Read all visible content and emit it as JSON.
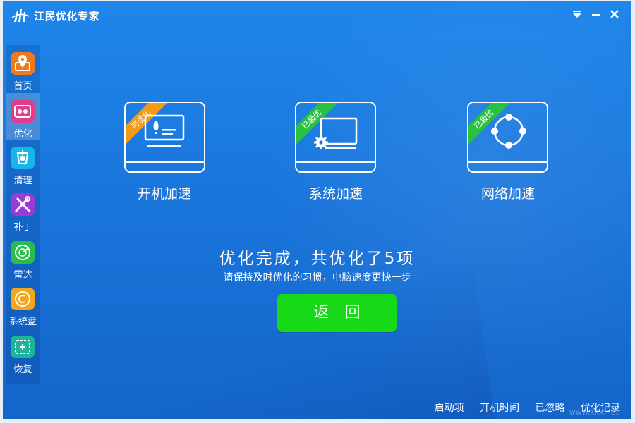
{
  "app": {
    "title": "江民优化专家"
  },
  "window_controls": {
    "menu_icon": "menu-dropdown-icon",
    "min_icon": "minimize-icon",
    "close_icon": "close-icon"
  },
  "sidebar": {
    "items": [
      {
        "label": "首页",
        "icon": "home-location-icon",
        "color": "#f07a1a",
        "active": false
      },
      {
        "label": "优化",
        "icon": "optimize-gauge-icon",
        "color": "#e23b8c",
        "active": true
      },
      {
        "label": "清理",
        "icon": "clean-broom-icon",
        "color": "#1ab5e8",
        "active": false
      },
      {
        "label": "补丁",
        "icon": "patch-tools-icon",
        "color": "#9b3ad6",
        "active": false
      },
      {
        "label": "雷达",
        "icon": "radar-icon",
        "color": "#2bbd4b",
        "active": false
      },
      {
        "label": "系统盘",
        "icon": "system-disk-icon",
        "color": "#f3a51b",
        "active": false
      },
      {
        "label": "恢复",
        "icon": "restore-icon",
        "color": "#1fb39a",
        "active": false
      }
    ]
  },
  "cards": [
    {
      "ribbon": "可优化",
      "ribbon_color": "orange",
      "label": "开机加速",
      "icon": "boot-monitor-icon"
    },
    {
      "ribbon": "已最优",
      "ribbon_color": "green",
      "label": "系统加速",
      "icon": "system-gear-monitor-icon"
    },
    {
      "ribbon": "已最优",
      "ribbon_color": "green",
      "label": "网络加速",
      "icon": "network-nodes-icon"
    }
  ],
  "result": {
    "title": "优化完成，共优化了5项",
    "subtitle": "请保持及时优化的习惯，电脑速度更快一步",
    "back_button": "返回"
  },
  "bottom_links": [
    "启动项",
    "开机时间",
    "已忽略",
    "优化记录"
  ],
  "watermark": "www.kkx.net"
}
